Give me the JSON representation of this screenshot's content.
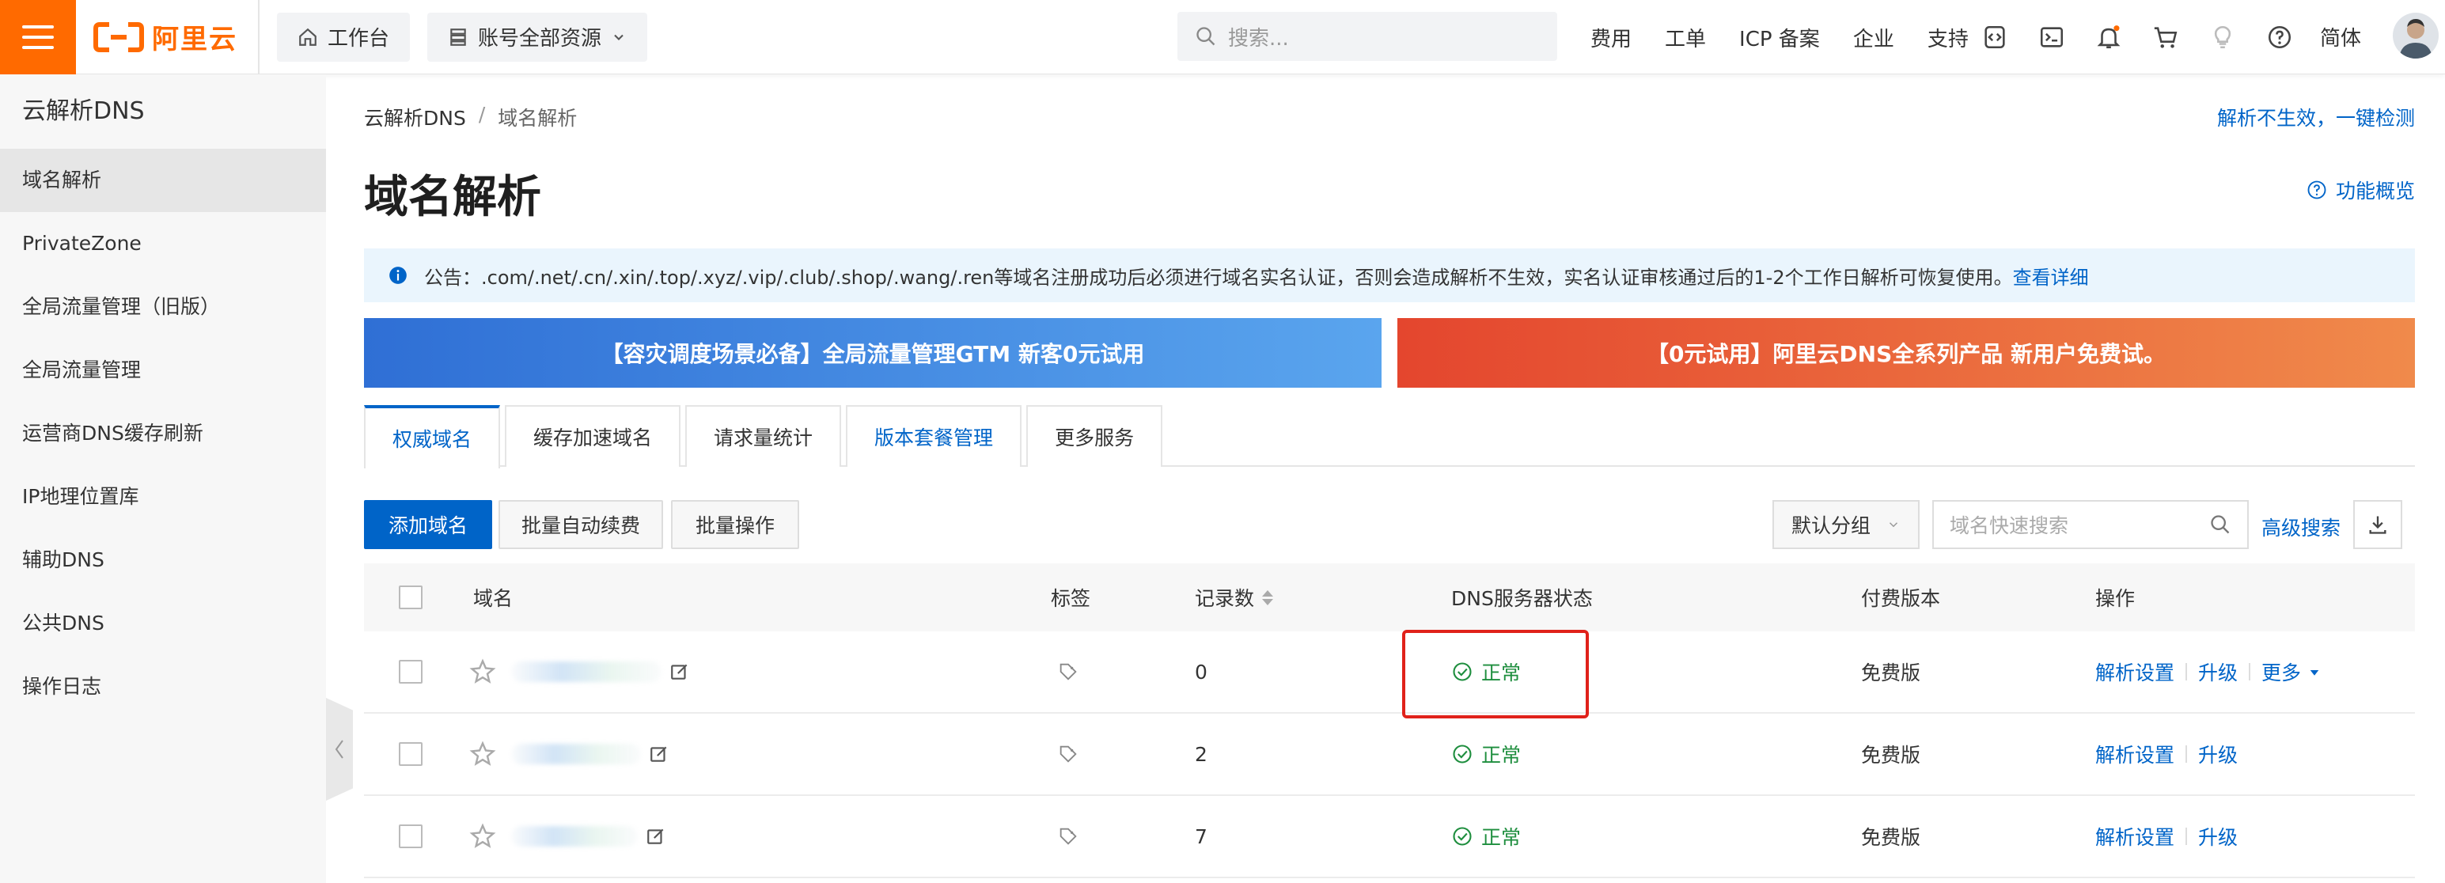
{
  "topbar": {
    "logo_text": "阿里云",
    "workbench": "工作台",
    "resources": "账号全部资源",
    "search_placeholder": "搜索...",
    "menu": [
      "费用",
      "工单",
      "ICP 备案",
      "企业",
      "支持"
    ],
    "lang": "简体",
    "brand_color": "#ff6a00"
  },
  "sidebar": {
    "title": "云解析DNS",
    "items": [
      {
        "label": "域名解析"
      },
      {
        "label": "PrivateZone"
      },
      {
        "label": "全局流量管理（旧版）"
      },
      {
        "label": "全局流量管理"
      },
      {
        "label": "运营商DNS缓存刷新"
      },
      {
        "label": "IP地理位置库"
      },
      {
        "label": "辅助DNS"
      },
      {
        "label": "公共DNS"
      },
      {
        "label": "操作日志"
      }
    ]
  },
  "main": {
    "breadcrumb": [
      "云解析DNS",
      "域名解析"
    ],
    "check_link": "解析不生效，一键检测",
    "title": "域名解析",
    "feature_link": "功能概览",
    "notice_text": "公告：.com/.net/.cn/.xin/.top/.xyz/.vip/.club/.shop/.wang/.ren等域名注册成功后必须进行域名实名认证，否则会造成解析不生效，实名认证审核通过后的1-2个工作日解析可恢复使用。",
    "notice_link": "查看详细",
    "banner_left": "【容灾调度场景必备】全局流量管理GTM 新客0元试用",
    "banner_right": "【0元试用】阿里云DNS全系列产品 新用户免费试。",
    "tabs": [
      "权威域名",
      "缓存加速域名",
      "请求量统计",
      "版本套餐管理",
      "更多服务"
    ],
    "toolbar": {
      "add": "添加域名",
      "auto_renew": "批量自动续费",
      "batch": "批量操作",
      "group": "默认分组",
      "search_placeholder": "域名快速搜索",
      "advanced": "高级搜索"
    },
    "table": {
      "headers": {
        "domain": "域名",
        "tag": "标签",
        "records": "记录数",
        "dns_status": "DNS服务器状态",
        "edition": "付费版本",
        "ops": "操作"
      },
      "rows": [
        {
          "records": "0",
          "status": "正常",
          "edition": "免费版",
          "op1": "解析设置",
          "op2": "升级",
          "op3": "更多"
        },
        {
          "records": "2",
          "status": "正常",
          "edition": "免费版",
          "op1": "解析设置",
          "op2": "升级"
        },
        {
          "records": "7",
          "status": "正常",
          "edition": "免费版",
          "op1": "解析设置",
          "op2": "升级"
        }
      ]
    }
  }
}
